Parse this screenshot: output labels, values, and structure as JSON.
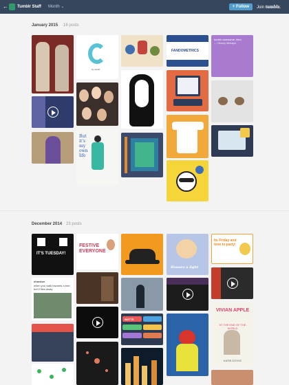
{
  "header": {
    "back_glyph": "←",
    "blog_name": "Tumblr Staff",
    "month_label": "Month",
    "follow_label": "+ Follow",
    "join_label": "Join",
    "brand": "tumblr."
  },
  "sections": [
    {
      "title": "January 2015",
      "count": "16 posts"
    },
    {
      "title": "December 2014",
      "count": "23 posts"
    }
  ],
  "tiles": {
    "fandometrics": "FANDOMETRICS",
    "handle_line": "tumblr username: tiled",
    "handle_sub": "— Hearty Mixtape",
    "its_tuesday": "IT'S TUESDAY!",
    "festive": "FESTIVE EVERYONE",
    "friday": "Its Friday and time to party!",
    "houses": "Houses a light",
    "text_post_1": "chunkee",
    "text_post_2": "when you walk towards a bird but it flies away",
    "butts": "BUTTS",
    "vivian": "VIVIAN APPLE",
    "vivian_sub": "AT THE END OF THE WORLD",
    "katie": "KATIE COYLE",
    "c_brand": "by tumblr",
    "blue_type": "But it's my own life"
  }
}
